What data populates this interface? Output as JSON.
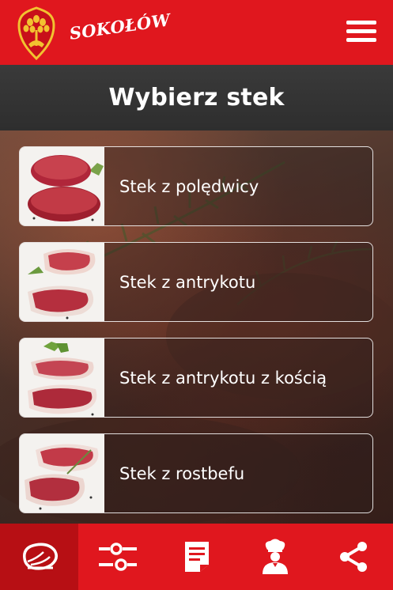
{
  "brand": {
    "name": "SOKOŁÓW",
    "color": "#e0171e"
  },
  "header": {
    "menu_icon": "hamburger-icon"
  },
  "page": {
    "title": "Wybierz stek"
  },
  "steaks": [
    {
      "label": "Stek z polędwicy"
    },
    {
      "label": "Stek z antrykotu"
    },
    {
      "label": "Stek z antrykotu z kością"
    },
    {
      "label": "Stek z rostbefu"
    }
  ],
  "bottom_nav": [
    {
      "icon": "steak-icon",
      "active": true
    },
    {
      "icon": "settings-sliders-icon",
      "active": false
    },
    {
      "icon": "document-icon",
      "active": false
    },
    {
      "icon": "chef-icon",
      "active": false
    },
    {
      "icon": "share-icon",
      "active": false
    }
  ]
}
